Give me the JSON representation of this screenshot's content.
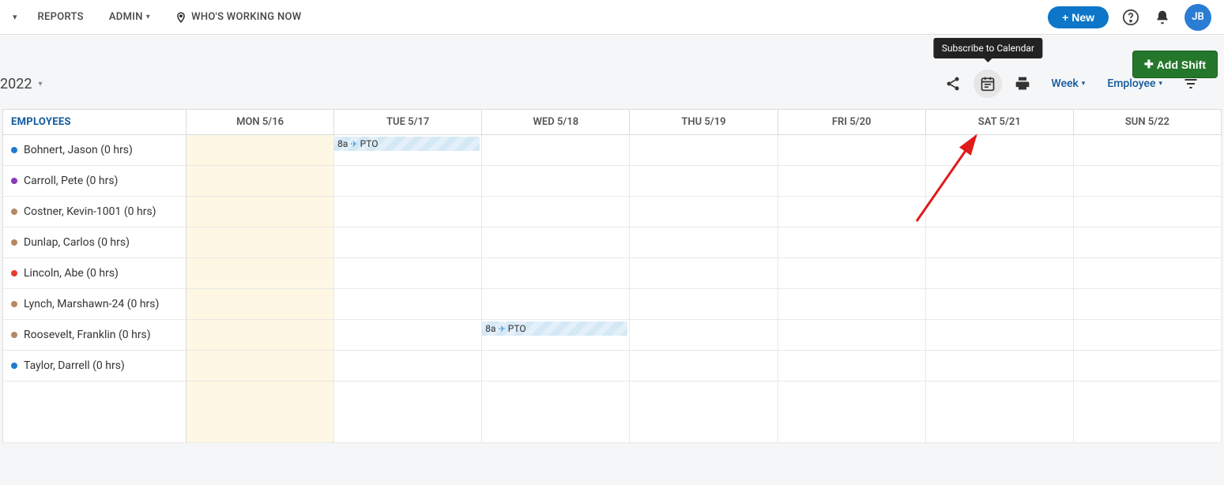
{
  "topnav": {
    "reports": "REPORTS",
    "admin": "ADMIN",
    "working": "WHO'S WORKING NOW",
    "new_btn": "+ New",
    "avatar": "JB"
  },
  "toolbar": {
    "add_shift": "Add Shift",
    "year": "2022",
    "tooltip": "Subscribe to Calendar",
    "week": "Week",
    "employee": "Employee"
  },
  "grid": {
    "emp_header": "EMPLOYEES",
    "days": [
      "MON 5/16",
      "TUE 5/17",
      "WED 5/18",
      "THU 5/19",
      "FRI 5/20",
      "SAT 5/21",
      "SUN 5/22"
    ]
  },
  "employees": [
    {
      "name": "Bohnert, Jason (0 hrs)",
      "dot": "#1f7ad1",
      "events": [
        {
          "day": 1,
          "time": "8a",
          "label": "PTO"
        }
      ]
    },
    {
      "name": "Carroll, Pete (0 hrs)",
      "dot": "#8a3ab9",
      "events": []
    },
    {
      "name": "Costner, Kevin-1001 (0 hrs)",
      "dot": "#b58863",
      "events": []
    },
    {
      "name": "Dunlap, Carlos (0 hrs)",
      "dot": "#b58863",
      "events": []
    },
    {
      "name": "Lincoln, Abe (0 hrs)",
      "dot": "#e43c2e",
      "events": []
    },
    {
      "name": "Lynch, Marshawn-24 (0 hrs)",
      "dot": "#b58863",
      "events": []
    },
    {
      "name": "Roosevelt, Franklin (0 hrs)",
      "dot": "#b58863",
      "events": [
        {
          "day": 2,
          "time": "8a",
          "label": "PTO"
        }
      ]
    },
    {
      "name": "Taylor, Darrell (0 hrs)",
      "dot": "#1f7ad1",
      "events": []
    }
  ]
}
